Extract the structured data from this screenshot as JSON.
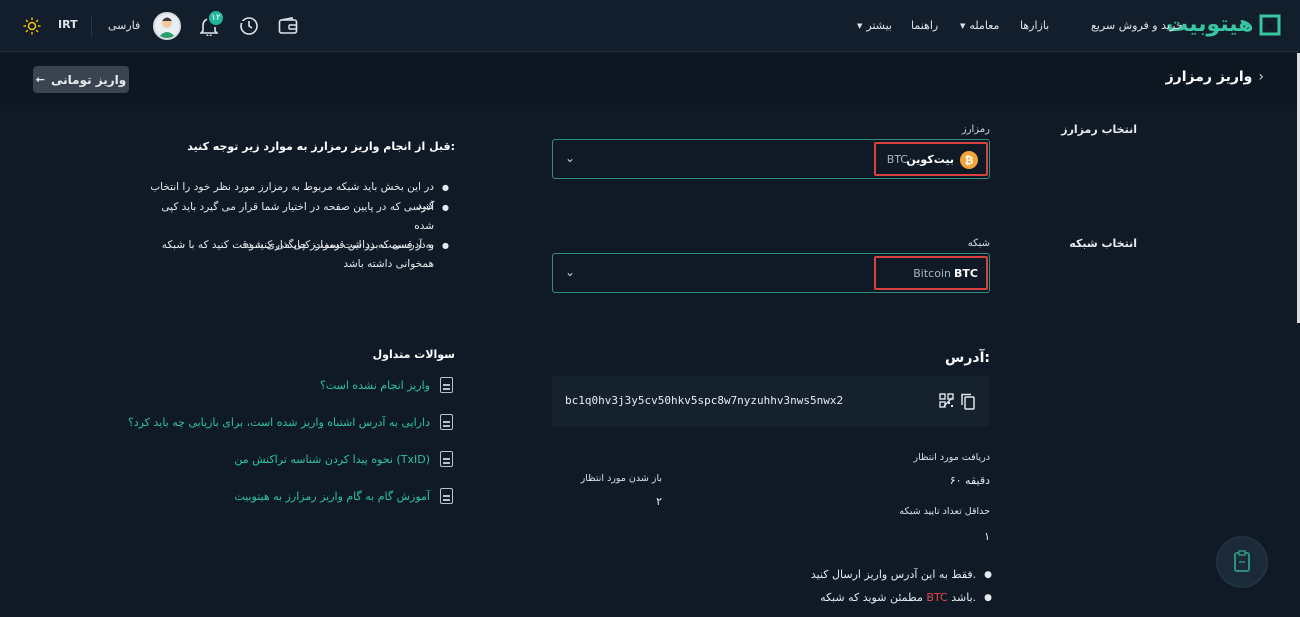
{
  "header": {
    "logo_text": "هیتوبیت",
    "nav": {
      "quick_trade": "خرید و فروش سریع",
      "markets": "بازارها",
      "trade": "معامله",
      "guide": "راهنما",
      "more": "بیشتر"
    },
    "notification_count": "۱۲",
    "language": "فارسی",
    "currency": "IRT"
  },
  "subbar": {
    "page_title": "واریز رمزارز",
    "toman_deposit_button": "واریز تومانی"
  },
  "form": {
    "select_crypto_label": "انتخاب رمزارز",
    "crypto_field_label": "رمزارز",
    "crypto_name": "بیت‌کوین",
    "crypto_symbol": "BTC",
    "select_network_label": "انتخاب شبکه",
    "network_field_label": "شبکه",
    "network_symbol": "BTC",
    "network_name": "Bitcoin"
  },
  "address": {
    "title": "آدرس:",
    "value": "bc1q0hv3j3y5cv50hkv5spc8w7nyzuhhv3nws5nwx2"
  },
  "details": {
    "expected_receive_label": "دریافت مورد انتظار",
    "expected_receive_value": "۶۰ دقیقه",
    "expected_unlock_label": "باز شدن مورد انتظار",
    "expected_unlock_value": "۲",
    "min_confirmations_label": "حداقل تعداد تایید شبکه",
    "min_confirmations_value": "۱"
  },
  "warnings": {
    "item1": "فقط به این آدرس واریز ارسال کنید.",
    "item2_prefix": "مطمئن شوید که شبکه",
    "item2_highlight": "BTC",
    "item2_suffix": "باشد."
  },
  "notes": {
    "title": "قبل از انجام واریز رمزارز به موارد زیر توجه کنید:",
    "item1": "در این بخش باید شبکه مربوط به رمزارز مورد نظر خود را انتخاب کنید",
    "item2_line1": "آدرسی که در پایین صفحه در اختیار شما قرار می گیرد باید کپی شده",
    "item2_line2": "و در قسمت برداشت رمزارز جایگذاری شود",
    "item3_line1": "به آدرسی که در این قسمت کپی می کنید دقت کنید که با شبکه",
    "item3_line2": "همخوانی داشته باشد"
  },
  "faq": {
    "title": "سوالات متداول",
    "items": [
      "واریز انجام نشده است؟",
      "دارایی به آدرس اشتباه واریز شده است، برای بازیابی چه باید کرد؟",
      "نحوه پیدا کردن شناسه تراکنش من (TxID)",
      "آموزش گام به گام واریز رمزارز به هیتوبیت"
    ]
  },
  "colors": {
    "accent": "#2cc3a0",
    "highlight_border": "#d94040",
    "bitcoin": "#f2a33a"
  }
}
